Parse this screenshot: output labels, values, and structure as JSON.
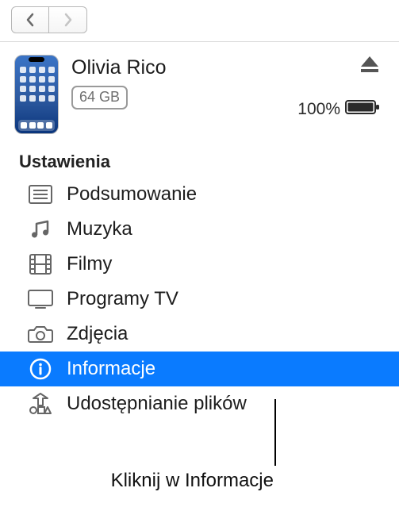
{
  "device": {
    "name": "Olivia Rico",
    "capacity": "64 GB",
    "battery_pct": "100%"
  },
  "sidebar": {
    "section_title": "Ustawienia",
    "items": [
      {
        "label": "Podsumowanie"
      },
      {
        "label": "Muzyka"
      },
      {
        "label": "Filmy"
      },
      {
        "label": "Programy TV"
      },
      {
        "label": "Zdjęcia"
      },
      {
        "label": "Informacje"
      },
      {
        "label": "Udostępnianie plików"
      }
    ],
    "selected_index": 5
  },
  "callout": "Kliknij w Informacje"
}
